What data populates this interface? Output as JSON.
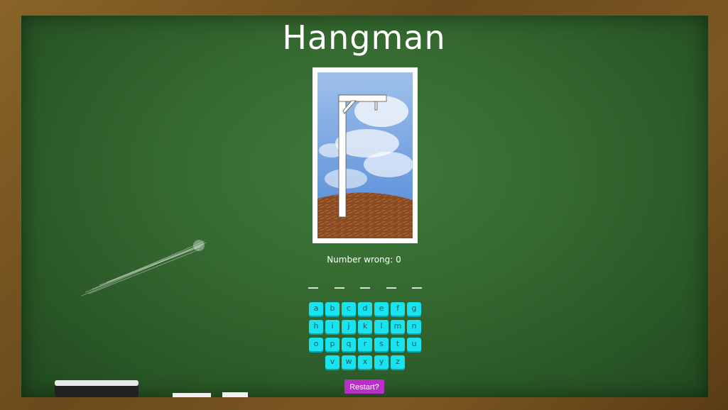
{
  "game": {
    "title": "Hangman",
    "wrong_label": "Number wrong: ",
    "wrong_count": "0",
    "blank_count": 5,
    "keyboard_rows": [
      [
        "a",
        "b",
        "c",
        "d",
        "e",
        "f",
        "g"
      ],
      [
        "h",
        "i",
        "j",
        "k",
        "l",
        "m",
        "n"
      ],
      [
        "o",
        "p",
        "q",
        "r",
        "s",
        "t",
        "u"
      ],
      [
        "v",
        "w",
        "x",
        "y",
        "z"
      ]
    ],
    "restart_label": "Restart?"
  },
  "colors": {
    "board": "#33672f",
    "key": "#19e3ef",
    "restart": "#b72fc4",
    "frame": "#6b4a1c"
  }
}
